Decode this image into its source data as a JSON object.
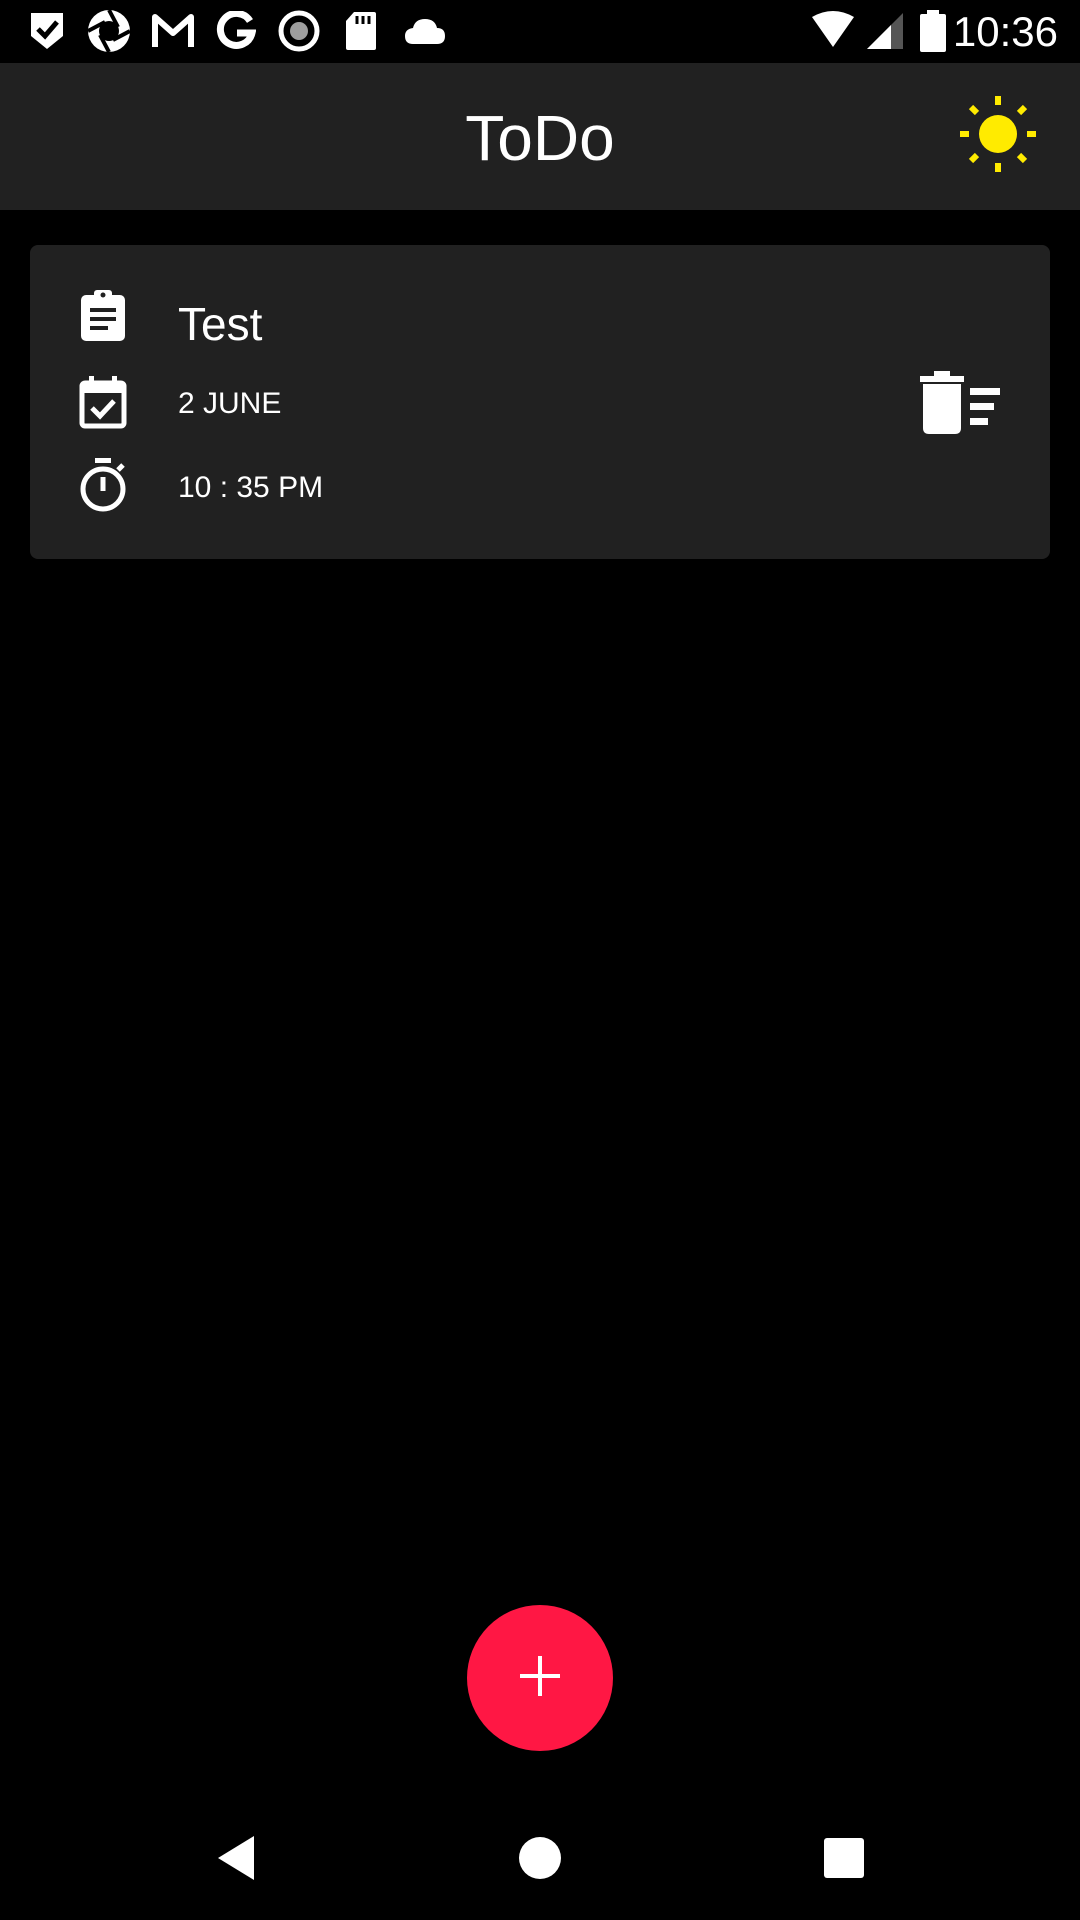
{
  "status_bar": {
    "time": "10:36",
    "left_icons": [
      "shield-check-icon",
      "camera-aperture-icon",
      "gmail-icon",
      "google-icon",
      "record-icon",
      "sd-card-icon",
      "cloud-icon"
    ],
    "right_icons": [
      "wifi-icon",
      "signal-icon",
      "battery-icon"
    ]
  },
  "app_bar": {
    "title": "ToDo",
    "theme_icon": "sun-icon",
    "theme_icon_color": "#FFEB00"
  },
  "tasks": [
    {
      "title": "Test",
      "date": "2 JUNE",
      "time": "10 : 35 PM"
    }
  ],
  "fab": {
    "icon": "plus-icon",
    "color": "#FF1744"
  },
  "nav_bar": {
    "buttons": [
      "back-icon",
      "home-icon",
      "recents-icon"
    ]
  },
  "colors": {
    "background": "#000000",
    "surface": "#212121",
    "text": "#FFFFFF"
  }
}
